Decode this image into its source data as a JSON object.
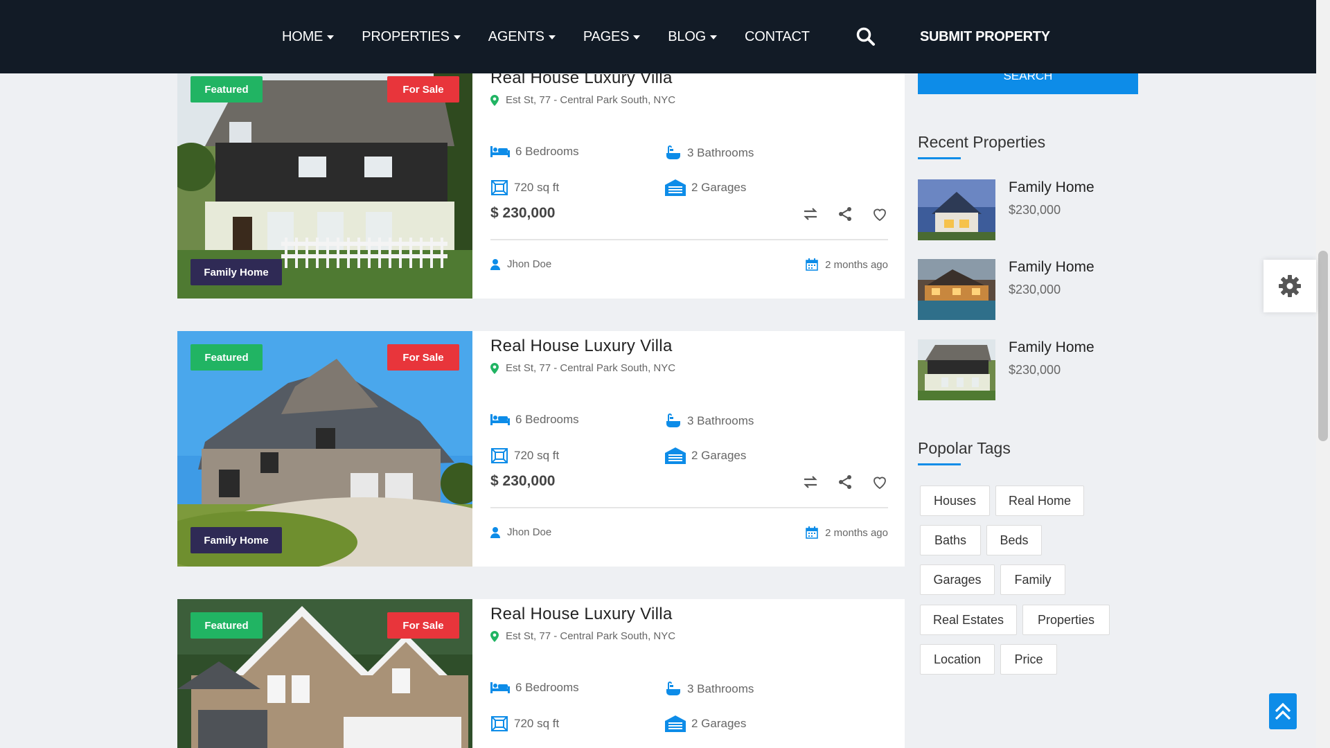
{
  "nav": {
    "items": [
      {
        "label": "HOME",
        "dropdown": true
      },
      {
        "label": "PROPERTIES",
        "dropdown": true
      },
      {
        "label": "AGENTS",
        "dropdown": true
      },
      {
        "label": "PAGES",
        "dropdown": true
      },
      {
        "label": "BLOG",
        "dropdown": true
      },
      {
        "label": "CONTACT",
        "dropdown": false
      }
    ],
    "submit_label": "SUBMIT PROPERTY"
  },
  "listings": [
    {
      "badge_featured": "Featured",
      "badge_status": "For Sale",
      "badge_type": "Family Home",
      "title": "Real House Luxury Villa",
      "address": "Est St, 77 - Central Park South, NYC",
      "bedrooms": "6 Bedrooms",
      "bathrooms": "3 Bathrooms",
      "area": "720 sq ft",
      "garages": "2 Garages",
      "price": "$ 230,000",
      "agent": "Jhon Doe",
      "date": "2 months ago"
    },
    {
      "badge_featured": "Featured",
      "badge_status": "For Sale",
      "badge_type": "Family Home",
      "title": "Real House Luxury Villa",
      "address": "Est St, 77 - Central Park South, NYC",
      "bedrooms": "6 Bedrooms",
      "bathrooms": "3 Bathrooms",
      "area": "720 sq ft",
      "garages": "2 Garages",
      "price": "$ 230,000",
      "agent": "Jhon Doe",
      "date": "2 months ago"
    },
    {
      "badge_featured": "Featured",
      "badge_status": "For Sale",
      "title": "Real House Luxury Villa",
      "address": "Est St, 77 - Central Park South, NYC",
      "bedrooms": "6 Bedrooms",
      "bathrooms": "3 Bathrooms",
      "area": "720 sq ft",
      "garages": "2 Garages"
    }
  ],
  "sidebar": {
    "search_label": "SEARCH",
    "recent_heading": "Recent Properties",
    "recent": [
      {
        "name": "Family Home",
        "price": "$230,000"
      },
      {
        "name": "Family Home",
        "price": "$230,000"
      },
      {
        "name": "Family Home",
        "price": "$230,000"
      }
    ],
    "tags_heading": "Popolar Tags",
    "tags": [
      "Houses",
      "Real Home",
      "Baths",
      "Beds",
      "Garages",
      "Family",
      "Real Estates",
      "Properties",
      "Location",
      "Price"
    ]
  },
  "colors": {
    "header_bg": "#121b26",
    "accent": "#0d8ce8",
    "featured": "#21b463",
    "for_sale": "#e8353b",
    "type_badge": "#2f2a55"
  }
}
